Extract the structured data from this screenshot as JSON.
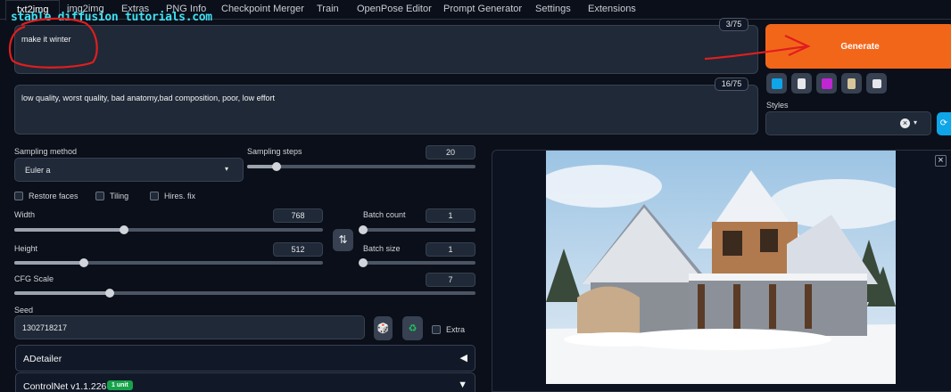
{
  "tabs": [
    {
      "label": "txt2img"
    },
    {
      "label": "img2img"
    },
    {
      "label": "Extras"
    },
    {
      "label": "PNG Info"
    },
    {
      "label": "Checkpoint Merger"
    },
    {
      "label": "Train"
    },
    {
      "label": "OpenPose Editor"
    },
    {
      "label": "Prompt Generator"
    },
    {
      "label": "Settings"
    },
    {
      "label": "Extensions"
    }
  ],
  "watermark": "stable diffusion tutorials.com",
  "prompt": {
    "value": "make it winter",
    "token_count": "3/75"
  },
  "negative_prompt": {
    "value": "low quality, worst quality, bad anatomy,bad composition, poor, low effort",
    "token_count": "16/75"
  },
  "generate_label": "Generate",
  "styles": {
    "label": "Styles",
    "clear": "×",
    "dropdown": "▾",
    "refresh": "⟳"
  },
  "sampling": {
    "method_label": "Sampling method",
    "method_value": "Euler a",
    "steps_label": "Sampling steps",
    "steps_value": "20",
    "steps_min": 1,
    "steps_max": 150
  },
  "checkboxes": {
    "restore_faces": "Restore faces",
    "tiling": "Tiling",
    "hires_fix": "Hires. fix",
    "extra": "Extra"
  },
  "width": {
    "label": "Width",
    "value": "768",
    "min": 64,
    "max": 2048
  },
  "height": {
    "label": "Height",
    "value": "512",
    "min": 64,
    "max": 2048
  },
  "swap_icon": "⇅",
  "batch_count": {
    "label": "Batch count",
    "value": "1",
    "min": 1,
    "max": 100
  },
  "batch_size": {
    "label": "Batch size",
    "value": "1",
    "min": 1,
    "max": 8
  },
  "cfg": {
    "label": "CFG Scale",
    "value": "7",
    "min": 1,
    "max": 30
  },
  "seed": {
    "label": "Seed",
    "value": "1302718217",
    "dice_icon": "🎲",
    "recycle_icon": "♻"
  },
  "accordions": {
    "adetailer": {
      "label": "ADetailer",
      "arrow": "◀"
    },
    "controlnet": {
      "label": "ControlNet v1.1.226",
      "badge": "1 unit",
      "arrow": "▼"
    }
  },
  "output": {
    "close": "×"
  },
  "colors": {
    "accent": "#f2661a",
    "bg": "#0b0f19",
    "annotation": "#e01e1e",
    "watermark": "#3fe0f2"
  }
}
